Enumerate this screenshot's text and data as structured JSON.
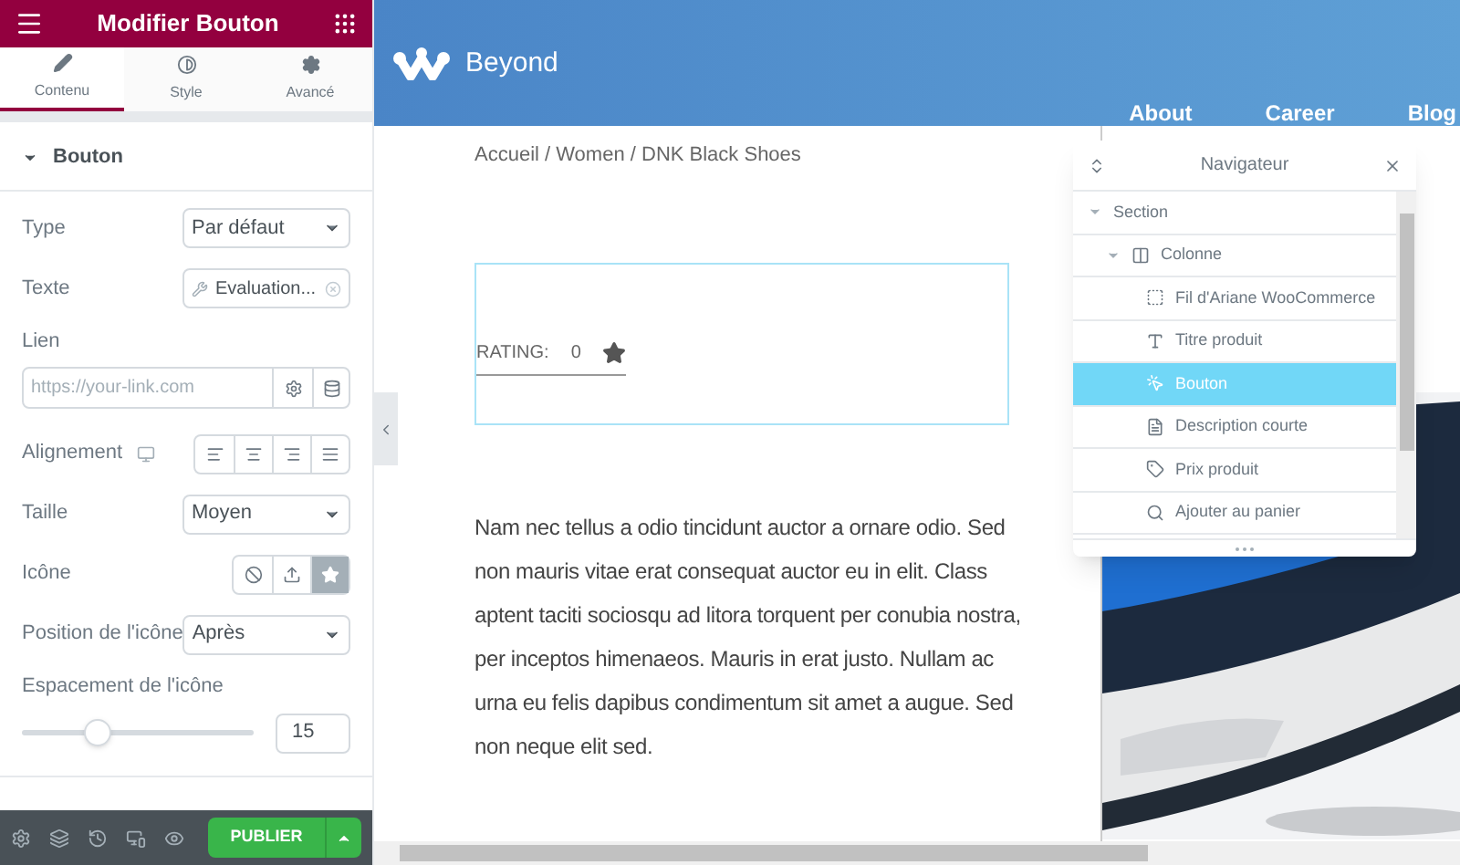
{
  "panel": {
    "title": "Modifier Bouton",
    "tabs": [
      {
        "label": "Contenu",
        "selected": true
      },
      {
        "label": "Style",
        "selected": false
      },
      {
        "label": "Avancé",
        "selected": false
      }
    ],
    "section": {
      "title": "Bouton",
      "expanded": true
    },
    "controls": [
      {
        "kind": "select",
        "label": "Type",
        "value": "Par défaut"
      },
      {
        "kind": "dynamic",
        "label": "Texte",
        "value": "Evaluation..."
      },
      {
        "kind": "url",
        "label": "Lien",
        "placeholder": "https://your-link.com"
      },
      {
        "kind": "align",
        "label": "Alignement",
        "options": [
          {
            "selected": false
          },
          {
            "selected": false
          },
          {
            "selected": false
          },
          {
            "selected": false
          }
        ]
      },
      {
        "kind": "select",
        "label": "Taille",
        "value": "Moyen"
      },
      {
        "kind": "choice",
        "label": "Icône",
        "options": [
          {
            "selected": false
          },
          {
            "selected": false
          },
          {
            "selected": true
          }
        ]
      },
      {
        "kind": "select",
        "label": "Position de l'icône",
        "value": "Après"
      },
      {
        "kind": "slider",
        "label": "Espacement de l'icône",
        "level": 0.3,
        "value": "15"
      }
    ],
    "publish": "PUBLIER"
  },
  "site": {
    "brand": "Beyond",
    "nav": [
      "About",
      "Career",
      "Blog"
    ],
    "breadcrumb": "Accueil / Women / DNK Black Shoes",
    "rating": {
      "label": "RATING:",
      "value": "0"
    },
    "description": "Nam nec tellus a odio tincidunt auctor a ornare odio. Sed non mauris vitae erat consequat auctor eu in elit. Class aptent taciti sociosqu ad litora torquent per conubia nostra, per inceptos himenaeos. Mauris in erat justo. Nullam ac urna eu felis dapibus condimentum sit amet a augue. Sed non neque elit sed."
  },
  "navigator": {
    "title": "Navigateur",
    "tree": [
      {
        "label": "Section",
        "expanded": true,
        "selected": false,
        "children": [
          {
            "label": "Colonne",
            "kind": "column",
            "expanded": true,
            "selected": false,
            "children": [
              {
                "label": "Fil d'Ariane WooCommerce",
                "kind": "breadcrumb",
                "selected": false
              },
              {
                "label": "Titre produit",
                "kind": "title",
                "selected": false
              },
              {
                "label": "Bouton",
                "kind": "button",
                "selected": true
              },
              {
                "label": "Description courte",
                "kind": "text",
                "selected": false
              },
              {
                "label": "Prix produit",
                "kind": "price",
                "selected": false
              },
              {
                "label": "Ajouter au panier",
                "kind": "cart",
                "selected": false
              }
            ]
          }
        ]
      }
    ]
  }
}
